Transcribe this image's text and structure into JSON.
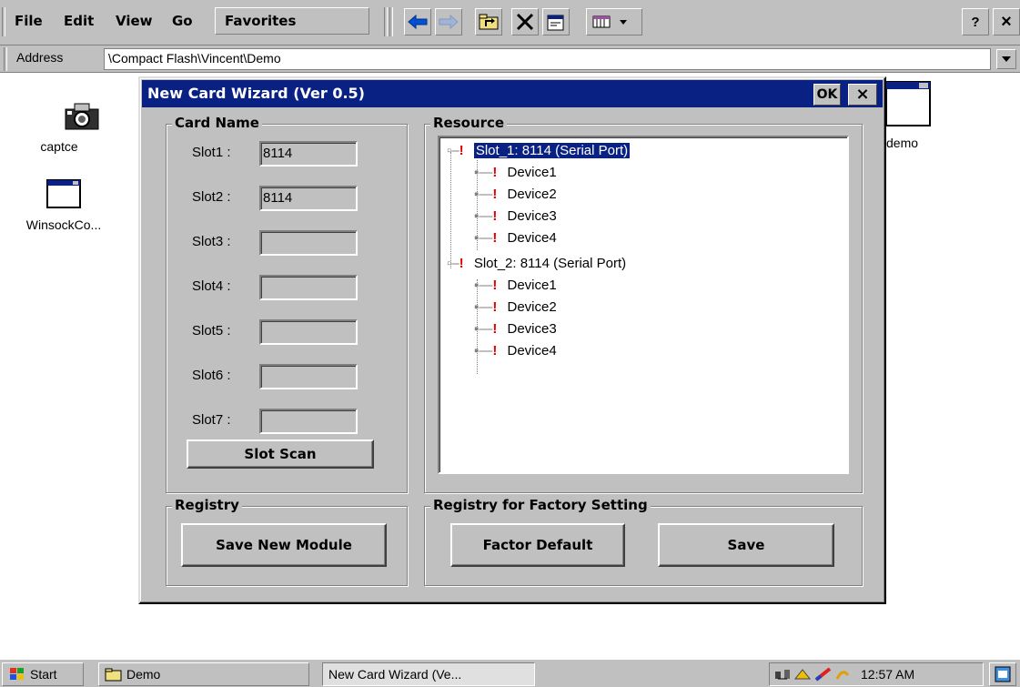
{
  "menu": {
    "file": "File",
    "edit": "Edit",
    "view": "View",
    "go": "Go",
    "favorites": "Favorites",
    "help": "?",
    "close": "×"
  },
  "address": {
    "label": "Address",
    "path": "\\Compact Flash\\Vincent\\Demo"
  },
  "desktop_icons": [
    {
      "label": "captce",
      "icon": "camera-icon"
    },
    {
      "label": "WinsockCo...",
      "icon": "window-icon"
    },
    {
      "label": "demo",
      "icon": "window-icon"
    }
  ],
  "dialog": {
    "title": "New Card Wizard (Ver 0.5)",
    "ok": "OK",
    "close": "×",
    "card_name": {
      "title": "Card Name",
      "slots": [
        {
          "label": "Slot1 :",
          "value": "8114"
        },
        {
          "label": "Slot2 :",
          "value": "8114"
        },
        {
          "label": "Slot3 :",
          "value": ""
        },
        {
          "label": "Slot4 :",
          "value": ""
        },
        {
          "label": "Slot5 :",
          "value": ""
        },
        {
          "label": "Slot6 :",
          "value": ""
        },
        {
          "label": "Slot7 :",
          "value": ""
        }
      ],
      "scan_button": "Slot Scan"
    },
    "resource": {
      "title": "Resource",
      "tree": [
        {
          "label": "Slot_1: 8114 (Serial Port)",
          "level": 0,
          "selected": true
        },
        {
          "label": "Device1",
          "level": 1
        },
        {
          "label": "Device2",
          "level": 1
        },
        {
          "label": "Device3",
          "level": 1
        },
        {
          "label": "Device4",
          "level": 1
        },
        {
          "label": "Slot_2: 8114 (Serial Port)",
          "level": 0
        },
        {
          "label": "Device1",
          "level": 1
        },
        {
          "label": "Device2",
          "level": 1
        },
        {
          "label": "Device3",
          "level": 1
        },
        {
          "label": "Device4",
          "level": 1
        }
      ]
    },
    "registry": {
      "title": "Registry",
      "save_new_module": "Save New Module"
    },
    "factory": {
      "title": "Registry for Factory Setting",
      "factor_default": "Factor Default",
      "save": "Save"
    }
  },
  "taskbar": {
    "start": "Start",
    "demo": "Demo",
    "wizard": "New Card Wizard (Ve...",
    "time": "12:57 AM"
  },
  "colors": {
    "titlebar": "#0a2184",
    "face": "#c0c0c0",
    "warning_icon": "#e00000"
  }
}
